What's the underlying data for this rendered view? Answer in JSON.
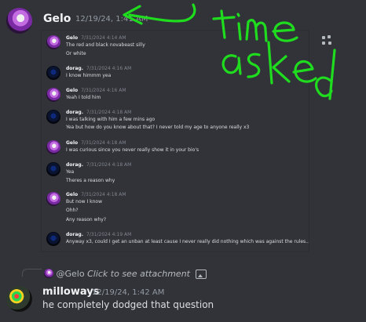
{
  "header": {
    "author": "Gelo",
    "timestamp": "12/19/24, 1:41 AM"
  },
  "screenshot": {
    "messages": [
      {
        "author": "Gelo",
        "time": "7/31/2024 4:14 AM",
        "avatar": "gelo",
        "lines": [
          "The red and black novabeast silly",
          "Or white"
        ]
      },
      {
        "author": "dorag.",
        "time": "7/31/2024 4:16 AM",
        "avatar": "dorag",
        "lines": [
          "I know himmm yea"
        ]
      },
      {
        "author": "Gelo",
        "time": "7/31/2024 4:16 AM",
        "avatar": "gelo",
        "lines": [
          "Yeah I told him"
        ]
      },
      {
        "author": "dorag.",
        "time": "7/31/2024 4:18 AM",
        "avatar": "dorag",
        "lines": [
          "I was talking with him a few mins ago",
          "Yea but how do you know about that? I never told my age to anyone really x3"
        ]
      },
      {
        "author": "Gelo",
        "time": "7/31/2024 4:18 AM",
        "avatar": "gelo",
        "lines": [
          "I was curious since you never really show it in your bio's"
        ]
      },
      {
        "author": "dorag.",
        "time": "7/31/2024 4:18 AM",
        "avatar": "dorag",
        "lines": [
          "Yea",
          "Theres a reason why"
        ]
      },
      {
        "author": "Gelo",
        "time": "7/31/2024 4:18 AM",
        "avatar": "gelo",
        "lines": [
          "But now I know",
          "Ohh?",
          "Any reason why?"
        ]
      },
      {
        "author": "dorag.",
        "time": "7/31/2024 4:19 AM",
        "avatar": "dorag",
        "lines": [
          "Anyway x3, could I get an unban at least cause I never really did nothing which was against the rules.."
        ]
      }
    ]
  },
  "annotation": {
    "text_line1": "time",
    "text_line2": "asked",
    "color": "#1fdc1f"
  },
  "reply": {
    "mention": "@Gelo",
    "hint": "Click to see attachment"
  },
  "message": {
    "author": "milloways",
    "timestamp": "12/19/24, 1:42 AM",
    "text": "he completely dodged that question"
  },
  "colors": {
    "background": "#313338",
    "username": "#f2f3f5",
    "muted": "#949ba4"
  }
}
